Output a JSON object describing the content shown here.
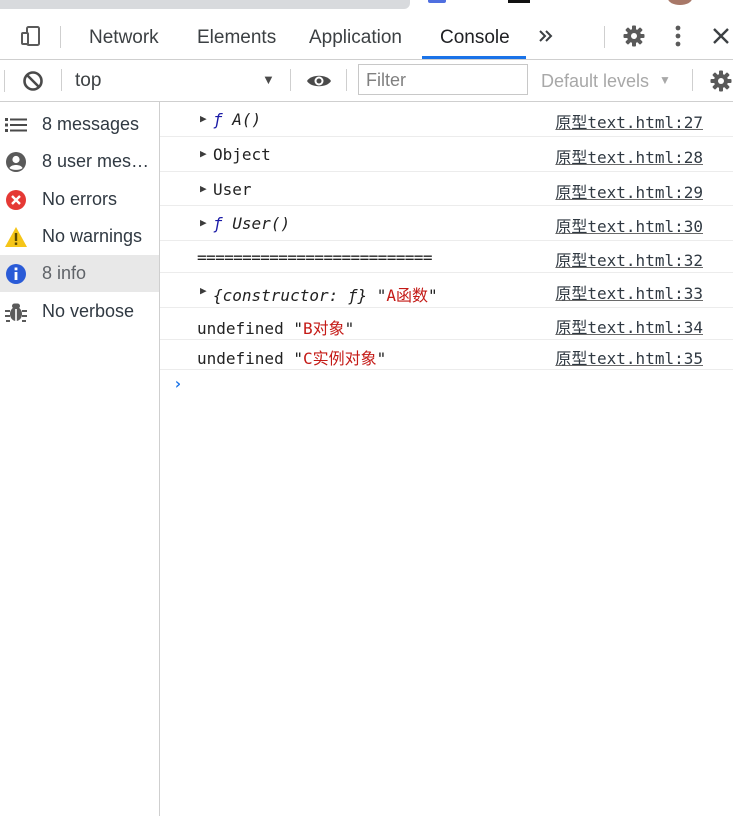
{
  "tabs": [
    "Network",
    "Elements",
    "Application",
    "Console"
  ],
  "toolbar": {
    "context": "top",
    "filter_placeholder": "Filter",
    "levels": "Default levels"
  },
  "sidebar": {
    "items": [
      {
        "label": "8 messages",
        "icon": "list-icon"
      },
      {
        "label": "8 user messages",
        "icon": "user-icon"
      },
      {
        "label": "No errors",
        "icon": "error-icon"
      },
      {
        "label": "No warnings",
        "icon": "warning-icon"
      },
      {
        "label": "8 info",
        "icon": "info-icon"
      },
      {
        "label": "No verbose",
        "icon": "bug-icon"
      }
    ]
  },
  "console": {
    "rows": [
      {
        "fn_prefix": "ƒ",
        "text": "A()",
        "source": "原型text.html:27"
      },
      {
        "text": "Object",
        "source": "原型text.html:28"
      },
      {
        "text": "User",
        "source": "原型text.html:29"
      },
      {
        "fn_prefix": "ƒ",
        "text": "User()",
        "source": "原型text.html:30"
      },
      {
        "text": "==========================",
        "source": "原型text.html:32"
      },
      {
        "obj": "{constructor: ƒ}",
        "str": "A函数",
        "source": "原型text.html:33"
      },
      {
        "text": "undefined",
        "str": "B对象",
        "source": "原型text.html:34"
      },
      {
        "text": "undefined",
        "str": "C实例对象",
        "source": "原型text.html:35"
      }
    ],
    "prompt": "›"
  },
  "colors": {
    "accent": "#1a73e8",
    "error": "#e53935",
    "warning": "#f5c518",
    "info": "#2a5bd7",
    "string": "#c41a16"
  }
}
